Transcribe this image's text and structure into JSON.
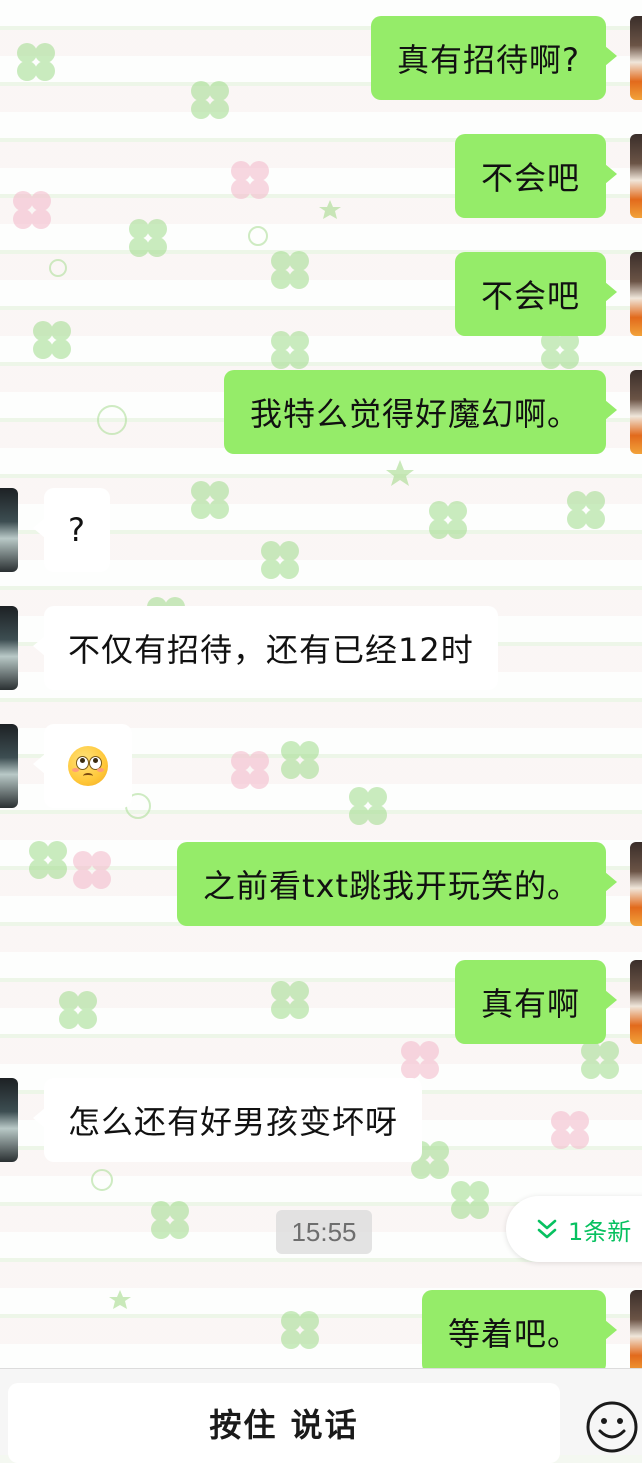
{
  "messages": [
    {
      "direction": "outgoing",
      "text": "真有招待啊?"
    },
    {
      "direction": "outgoing",
      "text": "不会吧"
    },
    {
      "direction": "outgoing",
      "text": "不会吧"
    },
    {
      "direction": "outgoing",
      "text": "我特么觉得好魔幻啊。"
    },
    {
      "direction": "incoming",
      "text": "?"
    },
    {
      "direction": "incoming",
      "text": "不仅有招待，还有已经12时"
    },
    {
      "direction": "incoming",
      "text": "",
      "emoji": "rolling-eyes-emoji"
    },
    {
      "direction": "outgoing",
      "text": "之前看txt跳我开玩笑的。"
    },
    {
      "direction": "outgoing",
      "text": "真有啊"
    },
    {
      "direction": "incoming",
      "text": "怎么还有好男孩变坏呀"
    },
    {
      "direction": "outgoing",
      "text": "等着吧。"
    }
  ],
  "timestamp": "15:55",
  "new_message_pill": {
    "label": "1条新",
    "icon": "double-chevron-down-icon"
  },
  "input_bar": {
    "hold_to_talk_label": "按住 说话",
    "emoji_icon": "smiley-face-icon"
  },
  "colors": {
    "outgoing_bubble": "#95ec69",
    "incoming_bubble": "#ffffff",
    "accent_green": "#07c160",
    "wallpaper_clover": "#8fd47a",
    "wallpaper_pink": "#f6c5d3"
  }
}
